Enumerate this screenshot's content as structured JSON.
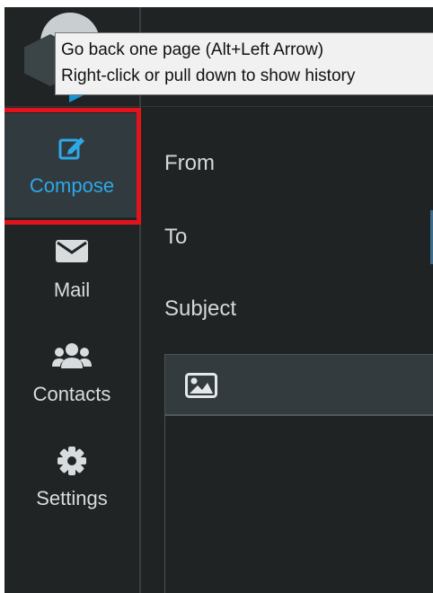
{
  "tooltip": {
    "line1": "Go back one page (Alt+Left Arrow)",
    "line2": "Right-click or pull down to show history"
  },
  "sidebar": {
    "items": [
      {
        "label": "Compose",
        "icon": "edit-icon",
        "active": true
      },
      {
        "label": "Mail",
        "icon": "envelope-icon",
        "active": false
      },
      {
        "label": "Contacts",
        "icon": "users-icon",
        "active": false
      },
      {
        "label": "Settings",
        "icon": "gear-icon",
        "active": false
      }
    ]
  },
  "compose": {
    "from_label": "From",
    "to_label": "To",
    "subject_label": "Subject",
    "toolbar_icon": "image-icon"
  },
  "colors": {
    "accent": "#2ea8e8",
    "highlight": "#e3131b",
    "background": "#1f2324"
  }
}
